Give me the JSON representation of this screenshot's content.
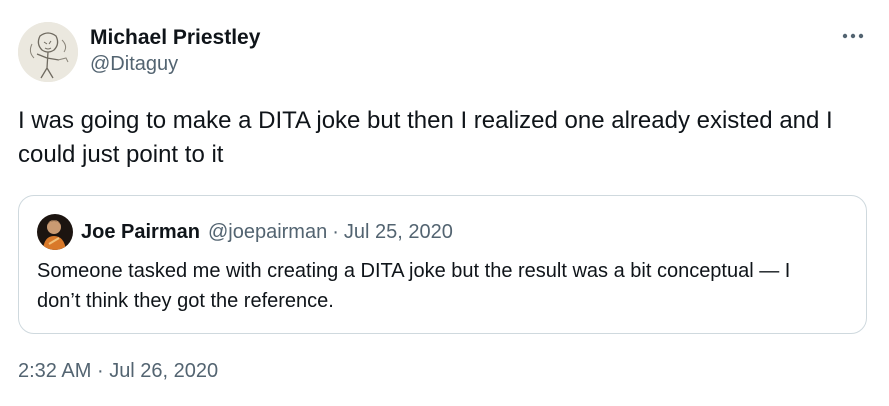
{
  "tweet": {
    "author": {
      "display_name": "Michael Priestley",
      "handle": "@Ditaguy"
    },
    "more_icon": "more-horizontal-icon",
    "text": "I was going to make a DITA joke but then I realized one already existed and I could just point to it",
    "quote": {
      "author": {
        "display_name": "Joe Pairman",
        "handle": "@joepairman"
      },
      "separator": "·",
      "date": "Jul 25, 2020",
      "text": "Someone tasked me with creating a DITA joke but the result was a bit conceptual — I don’t think they got the reference."
    },
    "timestamp": {
      "time": "2:32 AM",
      "separator": "·",
      "date": "Jul 26, 2020"
    }
  }
}
